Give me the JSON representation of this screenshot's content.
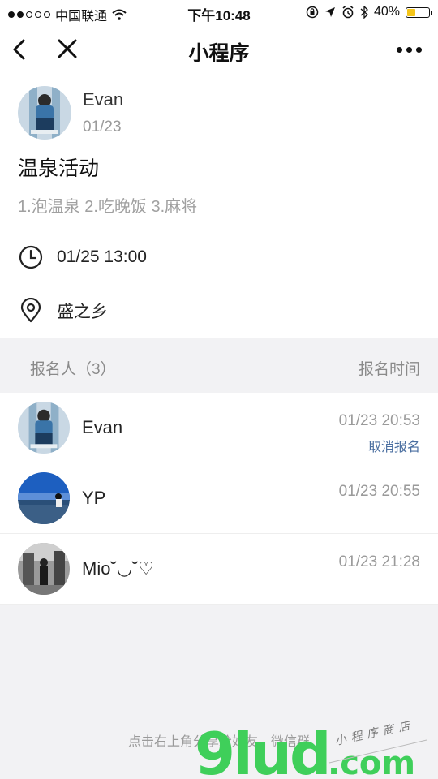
{
  "status_bar": {
    "carrier": "中国联通",
    "time": "下午10:48",
    "battery": "40%",
    "battery_level": 0.4
  },
  "nav": {
    "title": "小程序"
  },
  "event": {
    "author_name": "Evan",
    "author_date": "01/23",
    "title": "温泉活动",
    "description": "1.泡温泉 2.吃晚饭 3.麻将",
    "time": "01/25 13:00",
    "location": "盛之乡"
  },
  "list": {
    "header_left": "报名人（3）",
    "header_right": "报名时间",
    "items": [
      {
        "name": "Evan",
        "time": "01/23 20:53",
        "action": "取消报名"
      },
      {
        "name": "YP",
        "time": "01/23 20:55"
      },
      {
        "name": "Mio˘◡˘♡",
        "time": "01/23 21:28"
      }
    ]
  },
  "footer": {
    "share_hint": "点击右上角分享给好友、微信群"
  },
  "watermark": {
    "brand": "9lud",
    "domain": ".com",
    "tagline": "小程序商店"
  }
}
